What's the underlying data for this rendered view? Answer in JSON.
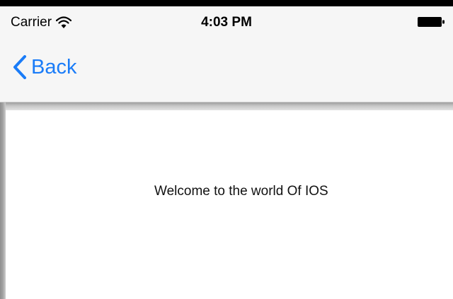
{
  "status_bar": {
    "carrier": "Carrier",
    "time": "4:03 PM",
    "wifi_icon": "wifi-icon",
    "battery_icon": "battery-icon"
  },
  "nav_bar": {
    "back_label": "Back",
    "back_icon": "chevron-left-icon",
    "accent_color": "#1a7cf8"
  },
  "content": {
    "welcome_text": "Welcome to the world Of IOS"
  }
}
